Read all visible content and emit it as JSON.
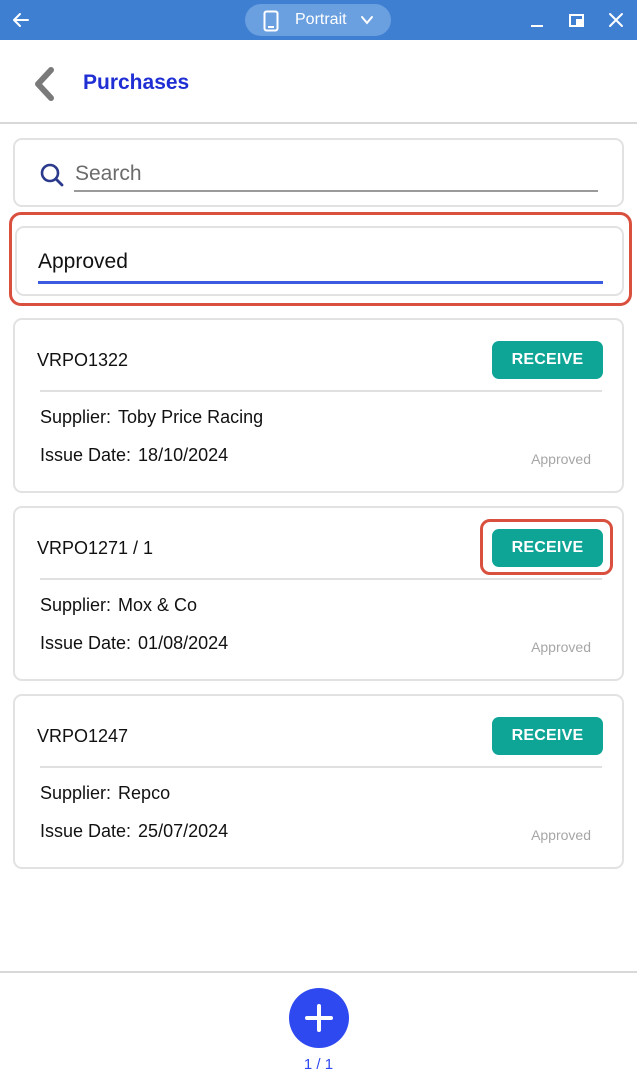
{
  "window": {
    "orientation_label": "Portrait"
  },
  "header": {
    "title": "Purchases"
  },
  "search": {
    "placeholder": "Search",
    "value": ""
  },
  "filter": {
    "value": "Approved"
  },
  "orders": [
    {
      "id": "VRPO1322",
      "action_label": "RECEIVE",
      "supplier_label": "Supplier:",
      "supplier": "Toby Price Racing",
      "date_label": "Issue Date:",
      "issue_date": "18/10/2024",
      "status": "Approved"
    },
    {
      "id": "VRPO1271 / 1",
      "action_label": "RECEIVE",
      "supplier_label": "Supplier:",
      "supplier": "Mox & Co",
      "date_label": "Issue Date:",
      "issue_date": "01/08/2024",
      "status": "Approved"
    },
    {
      "id": "VRPO1247",
      "action_label": "RECEIVE",
      "supplier_label": "Supplier:",
      "supplier": "Repco",
      "date_label": "Issue Date:",
      "issue_date": "25/07/2024",
      "status": "Approved"
    }
  ],
  "pagination": {
    "label": "1 / 1"
  },
  "colors": {
    "title_bar": "#3f7fd1",
    "accent": "#2f49f0",
    "title_text": "#1f2fd4",
    "receive_button": "#0ea597",
    "highlight": "#d9503f"
  },
  "icons": {
    "titlebar_back": "arrow-left-icon",
    "orientation": "phone-icon",
    "orientation_dropdown": "chevron-down-icon",
    "minimize": "minimize-icon",
    "restore": "restore-icon",
    "close": "close-icon",
    "nav_back": "chevron-left-icon",
    "search": "search-icon",
    "add": "plus-icon"
  }
}
